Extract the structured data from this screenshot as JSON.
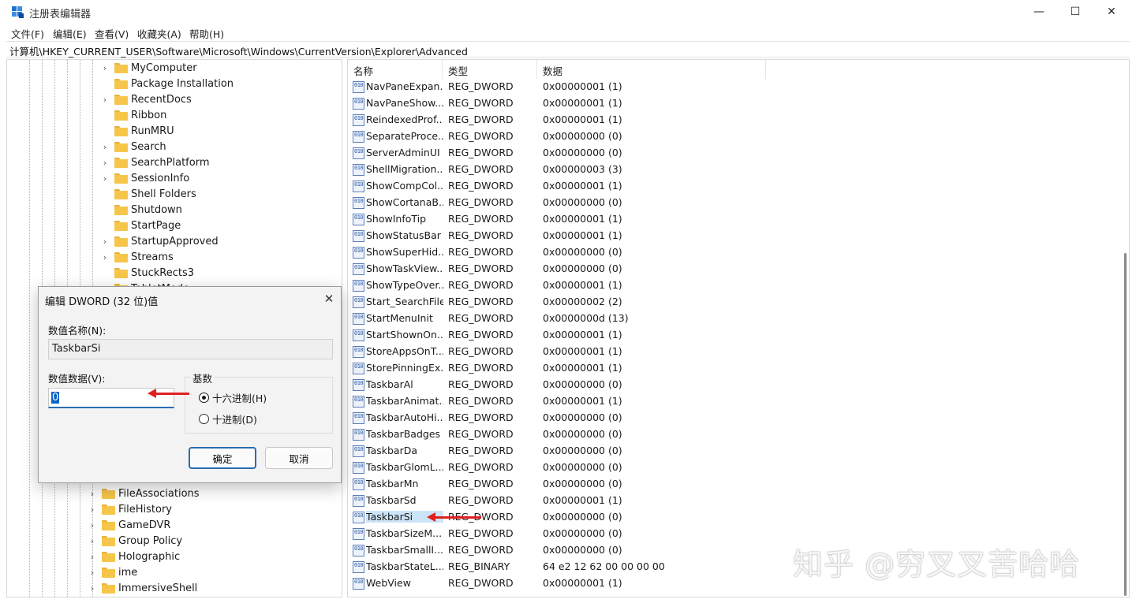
{
  "window": {
    "title": "注册表编辑器",
    "minimize": "—",
    "maximize": "☐",
    "close": "✕"
  },
  "menu": [
    "文件(F)",
    "编辑(E)",
    "查看(V)",
    "收藏夹(A)",
    "帮助(H)"
  ],
  "address": "计算机\\HKEY_CURRENT_USER\\Software\\Microsoft\\Windows\\CurrentVersion\\Explorer\\Advanced",
  "tree_top": [
    {
      "label": "MyComputer",
      "expandable": true
    },
    {
      "label": "Package Installation",
      "expandable": false
    },
    {
      "label": "RecentDocs",
      "expandable": true
    },
    {
      "label": "Ribbon",
      "expandable": false
    },
    {
      "label": "RunMRU",
      "expandable": false
    },
    {
      "label": "Search",
      "expandable": true
    },
    {
      "label": "SearchPlatform",
      "expandable": true
    },
    {
      "label": "SessionInfo",
      "expandable": true
    },
    {
      "label": "Shell Folders",
      "expandable": false
    },
    {
      "label": "Shutdown",
      "expandable": false
    },
    {
      "label": "StartPage",
      "expandable": false
    },
    {
      "label": "StartupApproved",
      "expandable": true
    },
    {
      "label": "Streams",
      "expandable": true
    },
    {
      "label": "StuckRects3",
      "expandable": false
    },
    {
      "label": "TabletMode",
      "expandable": false
    }
  ],
  "tree_bottom": [
    {
      "label": "FileAssociations",
      "expandable": true
    },
    {
      "label": "FileHistory",
      "expandable": true
    },
    {
      "label": "GameDVR",
      "expandable": true
    },
    {
      "label": "Group Policy",
      "expandable": true
    },
    {
      "label": "Holographic",
      "expandable": true
    },
    {
      "label": "ime",
      "expandable": true
    },
    {
      "label": "ImmersiveShell",
      "expandable": true
    }
  ],
  "list": {
    "headers": {
      "name": "名称",
      "type": "类型",
      "data": "数据"
    },
    "rows": [
      {
        "name": "NavPaneExpan...",
        "type": "REG_DWORD",
        "data": "0x00000001 (1)"
      },
      {
        "name": "NavPaneShow...",
        "type": "REG_DWORD",
        "data": "0x00000001 (1)"
      },
      {
        "name": "ReindexedProf...",
        "type": "REG_DWORD",
        "data": "0x00000001 (1)"
      },
      {
        "name": "SeparateProce...",
        "type": "REG_DWORD",
        "data": "0x00000000 (0)"
      },
      {
        "name": "ServerAdminUI",
        "type": "REG_DWORD",
        "data": "0x00000000 (0)"
      },
      {
        "name": "ShellMigration...",
        "type": "REG_DWORD",
        "data": "0x00000003 (3)"
      },
      {
        "name": "ShowCompCol...",
        "type": "REG_DWORD",
        "data": "0x00000001 (1)"
      },
      {
        "name": "ShowCortanaB...",
        "type": "REG_DWORD",
        "data": "0x00000000 (0)"
      },
      {
        "name": "ShowInfoTip",
        "type": "REG_DWORD",
        "data": "0x00000001 (1)"
      },
      {
        "name": "ShowStatusBar",
        "type": "REG_DWORD",
        "data": "0x00000001 (1)"
      },
      {
        "name": "ShowSuperHid...",
        "type": "REG_DWORD",
        "data": "0x00000000 (0)"
      },
      {
        "name": "ShowTaskView...",
        "type": "REG_DWORD",
        "data": "0x00000000 (0)"
      },
      {
        "name": "ShowTypeOver...",
        "type": "REG_DWORD",
        "data": "0x00000001 (1)"
      },
      {
        "name": "Start_SearchFiles",
        "type": "REG_DWORD",
        "data": "0x00000002 (2)"
      },
      {
        "name": "StartMenuInit",
        "type": "REG_DWORD",
        "data": "0x0000000d (13)"
      },
      {
        "name": "StartShownOn...",
        "type": "REG_DWORD",
        "data": "0x00000001 (1)"
      },
      {
        "name": "StoreAppsOnT...",
        "type": "REG_DWORD",
        "data": "0x00000001 (1)"
      },
      {
        "name": "StorePinningEx...",
        "type": "REG_DWORD",
        "data": "0x00000001 (1)"
      },
      {
        "name": "TaskbarAl",
        "type": "REG_DWORD",
        "data": "0x00000000 (0)"
      },
      {
        "name": "TaskbarAnimat...",
        "type": "REG_DWORD",
        "data": "0x00000001 (1)"
      },
      {
        "name": "TaskbarAutoHi...",
        "type": "REG_DWORD",
        "data": "0x00000000 (0)"
      },
      {
        "name": "TaskbarBadges",
        "type": "REG_DWORD",
        "data": "0x00000000 (0)"
      },
      {
        "name": "TaskbarDa",
        "type": "REG_DWORD",
        "data": "0x00000000 (0)"
      },
      {
        "name": "TaskbarGlomL...",
        "type": "REG_DWORD",
        "data": "0x00000000 (0)"
      },
      {
        "name": "TaskbarMn",
        "type": "REG_DWORD",
        "data": "0x00000000 (0)"
      },
      {
        "name": "TaskbarSd",
        "type": "REG_DWORD",
        "data": "0x00000001 (1)"
      },
      {
        "name": "TaskbarSi",
        "type": "REG_DWORD",
        "data": "0x00000000 (0)",
        "selected": true
      },
      {
        "name": "TaskbarSizeM...",
        "type": "REG_DWORD",
        "data": "0x00000000 (0)"
      },
      {
        "name": "TaskbarSmallI...",
        "type": "REG_DWORD",
        "data": "0x00000000 (0)"
      },
      {
        "name": "TaskbarStateL...",
        "type": "REG_BINARY",
        "data": "64 e2 12 62 00 00 00 00"
      },
      {
        "name": "WebView",
        "type": "REG_DWORD",
        "data": "0x00000001 (1)"
      }
    ]
  },
  "dialog": {
    "title": "编辑 DWORD (32 位)值",
    "close": "✕",
    "name_label": "数值名称(N):",
    "name_value": "TaskbarSi",
    "data_label": "数值数据(V):",
    "data_value": "0",
    "base_label": "基数",
    "hex_label": "十六进制(H)",
    "dec_label": "十进制(D)",
    "hex_checked": true,
    "ok": "确定",
    "cancel": "取消"
  },
  "watermark": "知乎 @穷叉叉苦哈哈",
  "colors": {
    "accent": "#2b6cb0",
    "annotation_arrow": "#e02020",
    "folder": "#f6c64b"
  }
}
